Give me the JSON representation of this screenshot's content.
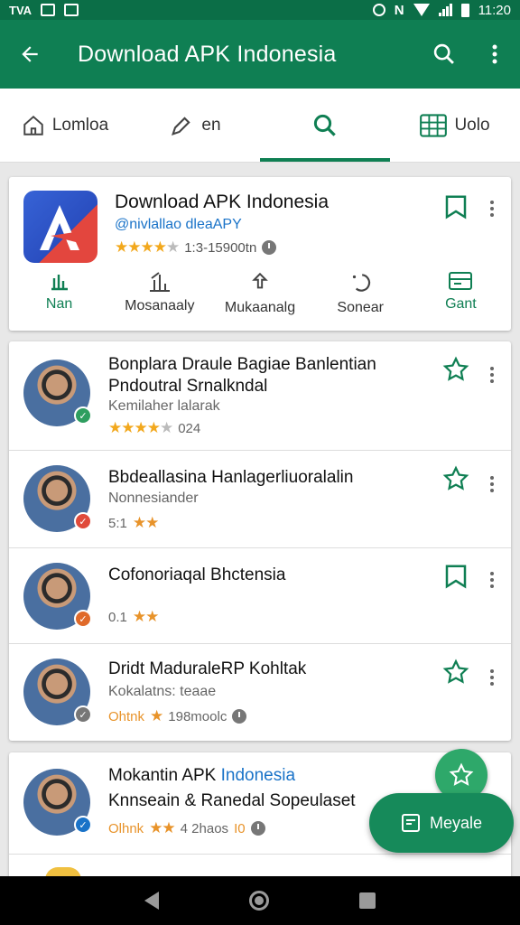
{
  "status_bar": {
    "time": "11:20",
    "left_label": "TVA"
  },
  "app_bar": {
    "title": "Download APK Indonesia"
  },
  "tabs": [
    {
      "label": "Lomloa",
      "icon": "home-icon"
    },
    {
      "label": "en",
      "icon": "edit-icon"
    },
    {
      "label": "",
      "icon": "search-icon",
      "active": true
    },
    {
      "label": "Uolo",
      "icon": "grid-icon"
    }
  ],
  "featured": {
    "title": "Download APK Indonesia",
    "subtitle": "@nivlallao dleaAPY",
    "rating_text": "1:3-15900tn",
    "stars": 4,
    "actions": [
      {
        "label": "Nan"
      },
      {
        "label": "Mosanaaly"
      },
      {
        "label": "Mukaanalg"
      },
      {
        "label": "Sonear"
      },
      {
        "label": "Gant"
      }
    ]
  },
  "list": [
    {
      "title_1": "Bonplara Draule Bagiae Banlentian",
      "title_2": "Pndoutral Srnalkndal",
      "sub": "Kemilaher lalarak",
      "meta": "024",
      "stars": 4,
      "badge_color": "#2e9e5f",
      "badge_icon": "check-icon"
    },
    {
      "title_1": "Bbdeallasina Hanlagerliuoralalin",
      "title_2": "",
      "sub": "Nonnesiander",
      "meta": "5:1",
      "stars": 2,
      "badge_color": "#e04a3a",
      "badge_icon": "check-icon"
    },
    {
      "title_1": "Cofonoriaqal Bhctensia",
      "title_2": "",
      "sub": "",
      "meta": "0.1",
      "stars": 2,
      "badge_color": "#e06a2a",
      "badge_icon": "check-icon"
    },
    {
      "title_1": "Dridt MaduraleRP Kohltak",
      "title_2": "",
      "sub": "Kokalatns: teaae",
      "meta": "Ohtnk",
      "meta2": "198moolc",
      "stars": 1,
      "badge_color": "#777777",
      "badge_icon": "check-icon"
    }
  ],
  "bottom": {
    "title_a": "Mokantin APK ",
    "title_b": "Indonesia",
    "line2": "Knnseain & Ranedal Sopeulaset",
    "meta": "Olhnk",
    "meta2": "4 2haos",
    "meta3": "I0"
  },
  "fab_label": "Meyale",
  "colors": {
    "primary": "#0f7f53",
    "accent": "#2ea86a",
    "link": "#1a73c8",
    "star": "#f2a81d"
  }
}
